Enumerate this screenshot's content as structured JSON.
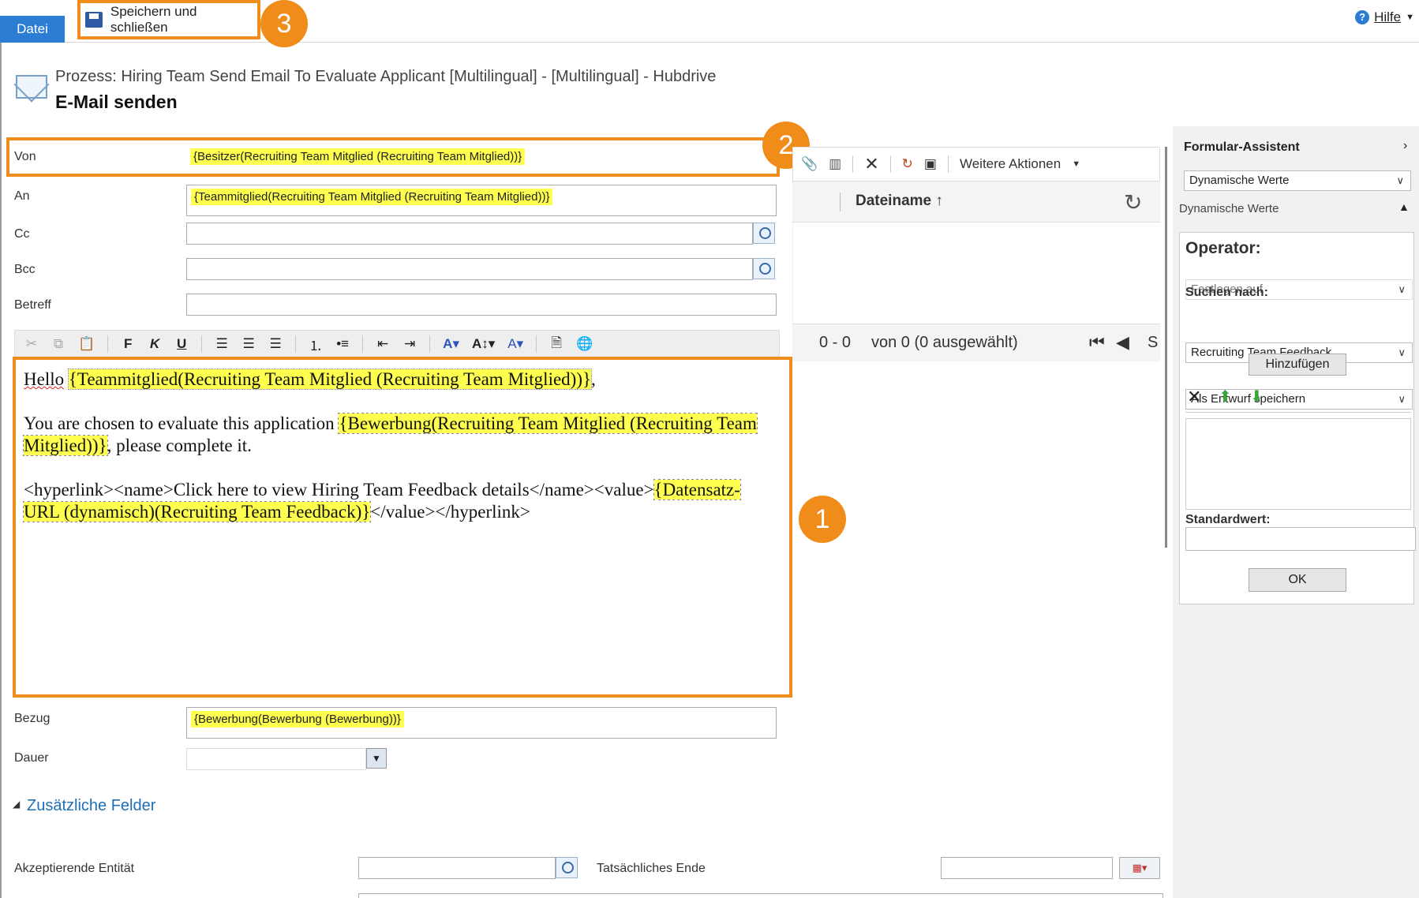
{
  "ribbon": {
    "file_label": "Datei",
    "save_close_label": "Speichern und schließen",
    "help_label": "Hilfe"
  },
  "callouts": {
    "c1": "1",
    "c2": "2",
    "c3": "3"
  },
  "header": {
    "process": "Prozess: Hiring Team Send Email To Evaluate Applicant [Multilingual] - [Multilingual] - Hubdrive",
    "title": "E-Mail senden"
  },
  "form": {
    "von": {
      "label": "Von",
      "value": "{Besitzer(Recruiting Team Mitglied (Recruiting Team Mitglied))}"
    },
    "an": {
      "label": "An",
      "value": "{Teammitglied(Recruiting Team Mitglied (Recruiting Team Mitglied))}"
    },
    "cc": {
      "label": "Cc",
      "value": ""
    },
    "bcc": {
      "label": "Bcc",
      "value": ""
    },
    "betreff": {
      "label": "Betreff",
      "value": ""
    },
    "bezug": {
      "label": "Bezug",
      "value": "{Bewerbung(Bewerbung (Bewerbung))}"
    },
    "dauer": {
      "label": "Dauer",
      "value": ""
    }
  },
  "toolbar": {
    "bold": "F",
    "italic": "K",
    "underline": "U",
    "more_actions": "Weitere Aktionen"
  },
  "editor": {
    "hello": "Hello",
    "hello_field": "{Teammitglied(Recruiting Team Mitglied (Recruiting Team Mitglied))}",
    "comma": ",",
    "line2_a": "You are chosen to evaluate this application",
    "line2_field": "{Bewerbung(Recruiting Team Mitglied (Recruiting Team Mitglied))}",
    "line2_b": ", please complete it.",
    "line3_a": "<hyperlink><name>Click here to view Hiring Team Feedback details</name><value>",
    "line3_field": "{Datensatz-URL (dynamisch)(Recruiting Team Feedback)}",
    "line3_b": "</value></hyperlink>"
  },
  "attachments": {
    "column_filename": "Dateiname",
    "sort_icon": "arrow-up",
    "count_text": "0 - 0",
    "count_of": "von 0 (0 ausgewählt)",
    "page_hint": "S"
  },
  "assistant": {
    "title": "Formular-Assistent",
    "mode_select": "Dynamische Werte",
    "section_label": "Dynamische Werte",
    "operator_label": "Operator:",
    "operator_value": "Festlegen auf",
    "search_label": "Suchen nach:",
    "search_entity": "Recruiting Team Feedback",
    "search_field": "Als Entwurf speichern",
    "add_button": "Hinzufügen",
    "default_label": "Standardwert:",
    "default_value": "",
    "ok_button": "OK"
  },
  "additional": {
    "section_label": "Zusätzliche Felder",
    "accepting_entity_label": "Akzeptierende Entität",
    "accepting_entity_value": "",
    "actual_end_label": "Tatsächliches Ende",
    "actual_end_value": ""
  },
  "colors": {
    "accent_orange": "#f08c1a",
    "highlight_yellow": "#ffff4f",
    "file_blue": "#2b7cd3",
    "link_blue": "#1e6fb5"
  }
}
